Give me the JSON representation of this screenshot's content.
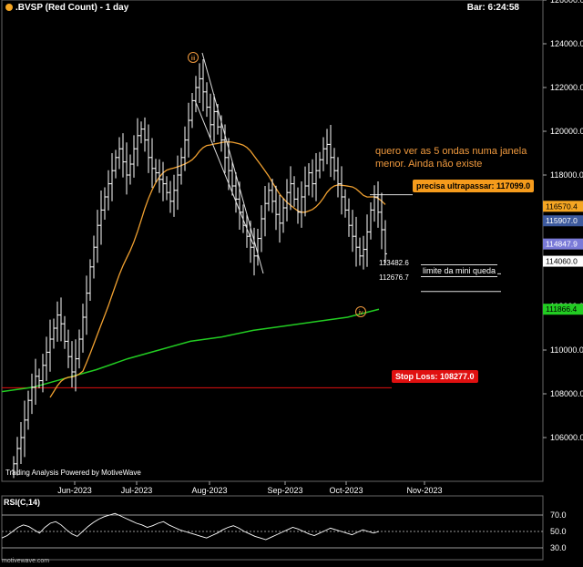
{
  "header": {
    "title": ".BVSP (Red Count) - 1 day",
    "bar_time": "Bar: 6:24:58"
  },
  "annotation": {
    "note": "quero ver as 5 ondas numa janela menor. Ainda não existe"
  },
  "labels": {
    "resistance": "precisa ultrapassar: 117099.0",
    "stop_loss": "Stop Loss: 108277.0",
    "mini_queda": "limite da mini queda",
    "val_upper": "113482.6",
    "val_lower": "112676.7",
    "wave_iii": "iii",
    "wave_iv": "iv"
  },
  "footer": {
    "credit": "Trading Analysis Powered by MotiveWave",
    "site": "motivewave.com"
  },
  "rsi": {
    "label": "RSI(C,14)",
    "ticks": [
      "70.0",
      "50.0",
      "30.0"
    ]
  },
  "colors": {
    "ma_fast": "#f0a030",
    "ma_slow": "#22cc22",
    "stop_loss": "#e01010",
    "resistance": "#f59b1c",
    "price_label_blue": "#3d5a9e",
    "price_label_purple": "#7a7ad8"
  },
  "chart_data": {
    "type": "candlestick",
    "ylim": [
      104000,
      126000
    ],
    "y_ticks": [
      "126000.0",
      "124000.0",
      "122000.0",
      "120000.0",
      "118000.0",
      "116000.0",
      "114000.0",
      "112000.0",
      "110000.0",
      "108000.0",
      "106000.0"
    ],
    "x_ticks": [
      "Jun-2023",
      "Jul-2023",
      "Aug-2023",
      "Sep-2023",
      "Oct-2023",
      "Nov-2023"
    ],
    "price_labels": [
      {
        "value": 116570.4,
        "text": "116570.4"
      },
      {
        "value": 115907.0,
        "text": "115907.0"
      },
      {
        "value": 114847.9,
        "text": "114847.9"
      },
      {
        "value": 114060.0,
        "text": "114060.0"
      },
      {
        "value": 111866.4,
        "text": "111866.4"
      }
    ],
    "levels": {
      "resistance": 117099.0,
      "stop_loss": 108277.0,
      "mini_queda_upper": 113482.6,
      "mini_queda_lower": 112676.7
    },
    "close": [
      104800,
      105500,
      106000,
      106800,
      107700,
      108300,
      108800,
      108600,
      109300,
      109900,
      110500,
      111000,
      111600,
      111200,
      110400,
      109700,
      109000,
      109600,
      110500,
      111500,
      112600,
      113800,
      114700,
      115700,
      116400,
      117000,
      117600,
      118200,
      118800,
      119200,
      118600,
      118000,
      118500,
      119200,
      119800,
      120100,
      119600,
      118800,
      118300,
      118100,
      117800,
      117600,
      117200,
      116800,
      117300,
      118000,
      118800,
      119600,
      120500,
      121400,
      122000,
      122400,
      121800,
      121100,
      120300,
      120900,
      120200,
      119600,
      118800,
      118200,
      117500,
      116900,
      116300,
      115700,
      115200,
      114700,
      114300,
      115100,
      116000,
      116700,
      117300,
      116800,
      116200,
      115800,
      116500,
      117200,
      117600,
      116900,
      116300,
      117000,
      117500,
      118100,
      117600,
      118200,
      118700,
      119200,
      119400,
      118800,
      118200,
      117600,
      117000,
      116400,
      115700,
      115200,
      114700,
      114300,
      114600,
      115400,
      116400,
      117000,
      116300,
      115500,
      114400
    ]
  }
}
